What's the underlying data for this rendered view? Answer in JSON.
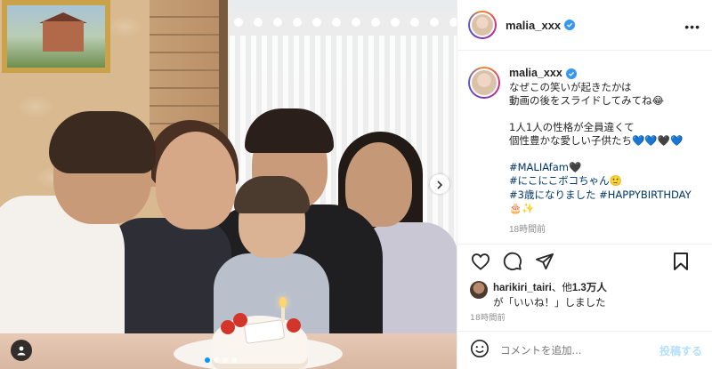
{
  "post": {
    "username": "malia_xxx",
    "verified": true,
    "more_label": "•••",
    "media_dots": {
      "count": 4,
      "active_index": 0
    }
  },
  "caption": {
    "username": "malia_xxx",
    "lines": [
      "なぜこの笑いが起きたかは",
      "動画の後をスライドしてみてね😂",
      "",
      "1人1人の性格が全員違くて",
      "個性豊かな愛しい子供たち💙💙🖤💙",
      "",
      "#MALIAfam🖤",
      "#にこにこボコちゃん🙂",
      "#3歳になりました #HAPPYBIRTHDAY",
      "🎂✨"
    ],
    "time": "18時間前"
  },
  "likes": {
    "liker": "harikiri_tairi",
    "others_prefix": "、他",
    "others_count": "1.3万人",
    "line2": "が「いいね！」しました"
  },
  "post_time": "18時間前",
  "comment": {
    "placeholder": "コメントを追加...",
    "post_label": "投稿する"
  },
  "icons": {
    "like": "heart-icon",
    "comment": "comment-icon",
    "share": "paper-plane-icon",
    "save": "bookmark-icon",
    "emoji": "smiley-icon",
    "next": "chevron-right-icon",
    "tag": "user-tag-icon",
    "verified": "verified-badge-icon"
  },
  "colors": {
    "accent": "#0095f6",
    "verified": "#3897f0",
    "hashtag": "#00376b",
    "muted": "#8e8e8e",
    "post_disabled": "#b2dffc"
  }
}
